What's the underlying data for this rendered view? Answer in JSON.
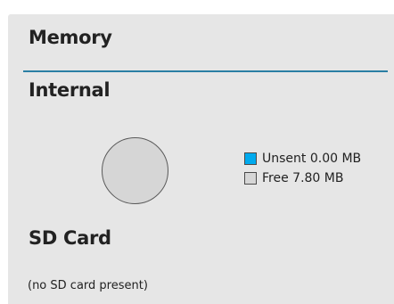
{
  "panel": {
    "title": "Memory"
  },
  "internal": {
    "title": "Internal",
    "legend": [
      {
        "label": "Unsent 0.00 MB",
        "color": "#00aaee"
      },
      {
        "label": "Free 7.80 MB",
        "color": "#d6d6d6"
      }
    ]
  },
  "sd_card": {
    "title": "SD Card",
    "status": "(no SD card present)"
  },
  "colors": {
    "accent_divider": "#2a7fa4",
    "panel_bg": "#e6e6e6"
  }
}
